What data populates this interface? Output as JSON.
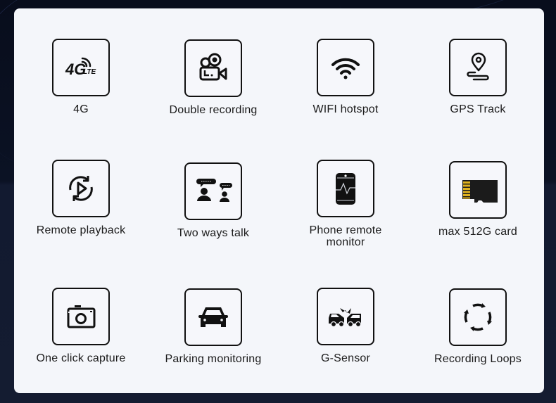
{
  "features": [
    {
      "label": "4G",
      "icon": "4g-lte-icon",
      "badge_main": "4G",
      "badge_sub": "LTE"
    },
    {
      "label": "Double recording",
      "icon": "video-camera-icon"
    },
    {
      "label": "WIFI hotspot",
      "icon": "wifi-icon"
    },
    {
      "label": "GPS Track",
      "icon": "gps-pin-icon"
    },
    {
      "label": "Remote playback",
      "icon": "remote-playback-icon"
    },
    {
      "label": "Two ways talk",
      "icon": "two-way-talk-icon"
    },
    {
      "label": "Phone remote monitor",
      "icon": "phone-monitor-icon"
    },
    {
      "label": "max 512G card",
      "icon": "sd-card-icon"
    },
    {
      "label": "One click capture",
      "icon": "camera-icon"
    },
    {
      "label": "Parking monitoring",
      "icon": "car-icon"
    },
    {
      "label": "G-Sensor",
      "icon": "car-collision-icon"
    },
    {
      "label": "Recording Loops",
      "icon": "loop-arrows-icon"
    }
  ],
  "colors": {
    "card_bg": "#f4f6fa",
    "icon_stroke": "#111111",
    "sd_contacts": "#e0b21e",
    "page_bg": "#0b1224"
  }
}
